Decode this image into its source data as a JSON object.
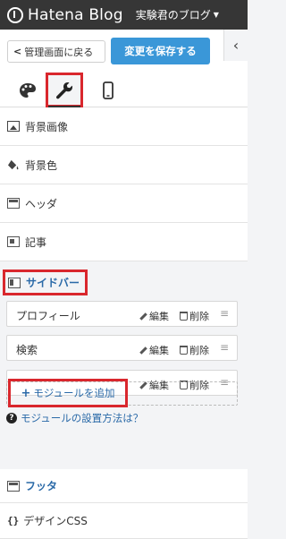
{
  "header": {
    "brand": "Hatena Blog",
    "blog_name": "実験君のブログ"
  },
  "toolbar": {
    "back_label": "管理画面に戻る",
    "save_label": "変更を保存する",
    "collapse_icon": "chevron-left-icon"
  },
  "tabs": [
    {
      "name": "design-palette",
      "icon": "palette-icon"
    },
    {
      "name": "customize",
      "icon": "wrench-icon",
      "highlighted": true
    },
    {
      "name": "smartphone",
      "icon": "smartphone-icon"
    }
  ],
  "sections": {
    "background_image": "背景画像",
    "background_color": "背景色",
    "header": "ヘッダ",
    "article": "記事",
    "sidebar": "サイドバー",
    "footer": "フッタ",
    "design_css": "デザインCSS",
    "design_css_icon": "{}"
  },
  "sidebar": {
    "modules": [
      {
        "name": "プロフィール",
        "edit": "編集",
        "delete": "削除",
        "handle": "≡"
      },
      {
        "name": "検索",
        "edit": "編集",
        "delete": "削除",
        "handle": "≡"
      },
      {
        "name": "",
        "edit": "編集",
        "delete": "削除",
        "handle": "≡"
      }
    ],
    "add_module": "モジュールを追加",
    "add_plus": "+",
    "help": "モジュールの設置方法は？",
    "help_icon": "?"
  },
  "colors": {
    "topbar": "#363636",
    "accent_blue": "#3a97d8",
    "highlight_red": "#d9272d",
    "link_blue": "#2b6aa8"
  }
}
